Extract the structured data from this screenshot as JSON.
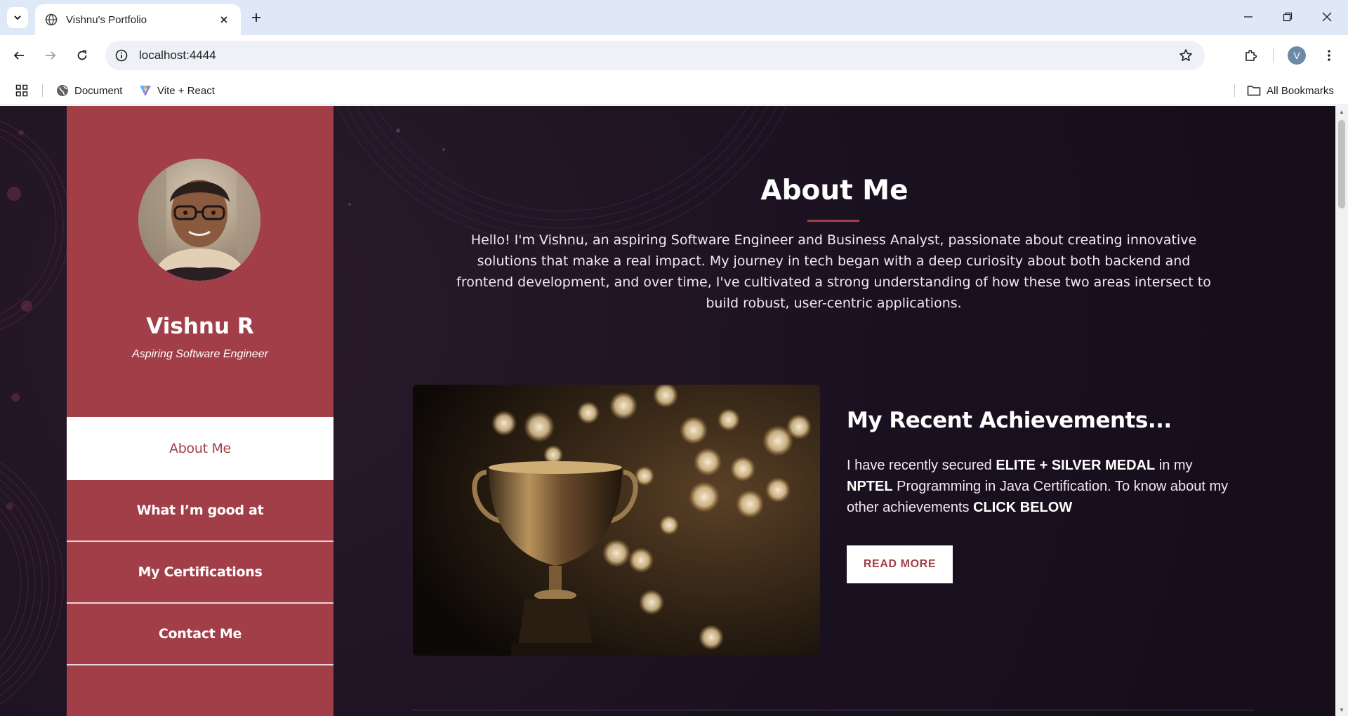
{
  "browser": {
    "tab_title": "Vishnu's Portfolio",
    "url": "localhost:4444",
    "profile_initial": "V",
    "bookmarks": [
      {
        "label": "Document",
        "icon": "globe-icon"
      },
      {
        "label": "Vite + React",
        "icon": "vite-icon"
      }
    ],
    "all_bookmarks_label": "All Bookmarks"
  },
  "sidebar": {
    "name": "Vishnu R",
    "role": "Aspiring Software Engineer",
    "nav": [
      {
        "label": "About Me",
        "active": true
      },
      {
        "label": "What I’m good at",
        "active": false
      },
      {
        "label": "My Certifications",
        "active": false
      },
      {
        "label": "Contact Me",
        "active": false
      }
    ]
  },
  "about": {
    "title": "About Me",
    "text": "Hello! I'm Vishnu, an aspiring Software Engineer and Business Analyst, passionate about creating innovative solutions that make a real impact. My journey in tech began with a deep curiosity about both backend and frontend development, and over time, I've cultivated a strong understanding of how these two areas intersect to build robust, user-centric applications."
  },
  "achievements": {
    "title": "My Recent Achievements...",
    "text_parts": {
      "p1": "I have recently secured ",
      "b1": "ELITE + SILVER MEDAL",
      "p2": " in my ",
      "b2": "NPTEL",
      "p3": " Programming in Java Certification. To know about my other achievements ",
      "b3": "CLICK BELOW"
    },
    "button_label": "READ MORE"
  },
  "colors": {
    "accent": "#a23e48",
    "page_bg": "#1d1320",
    "chrome_tabbar": "#dfe8f7"
  }
}
